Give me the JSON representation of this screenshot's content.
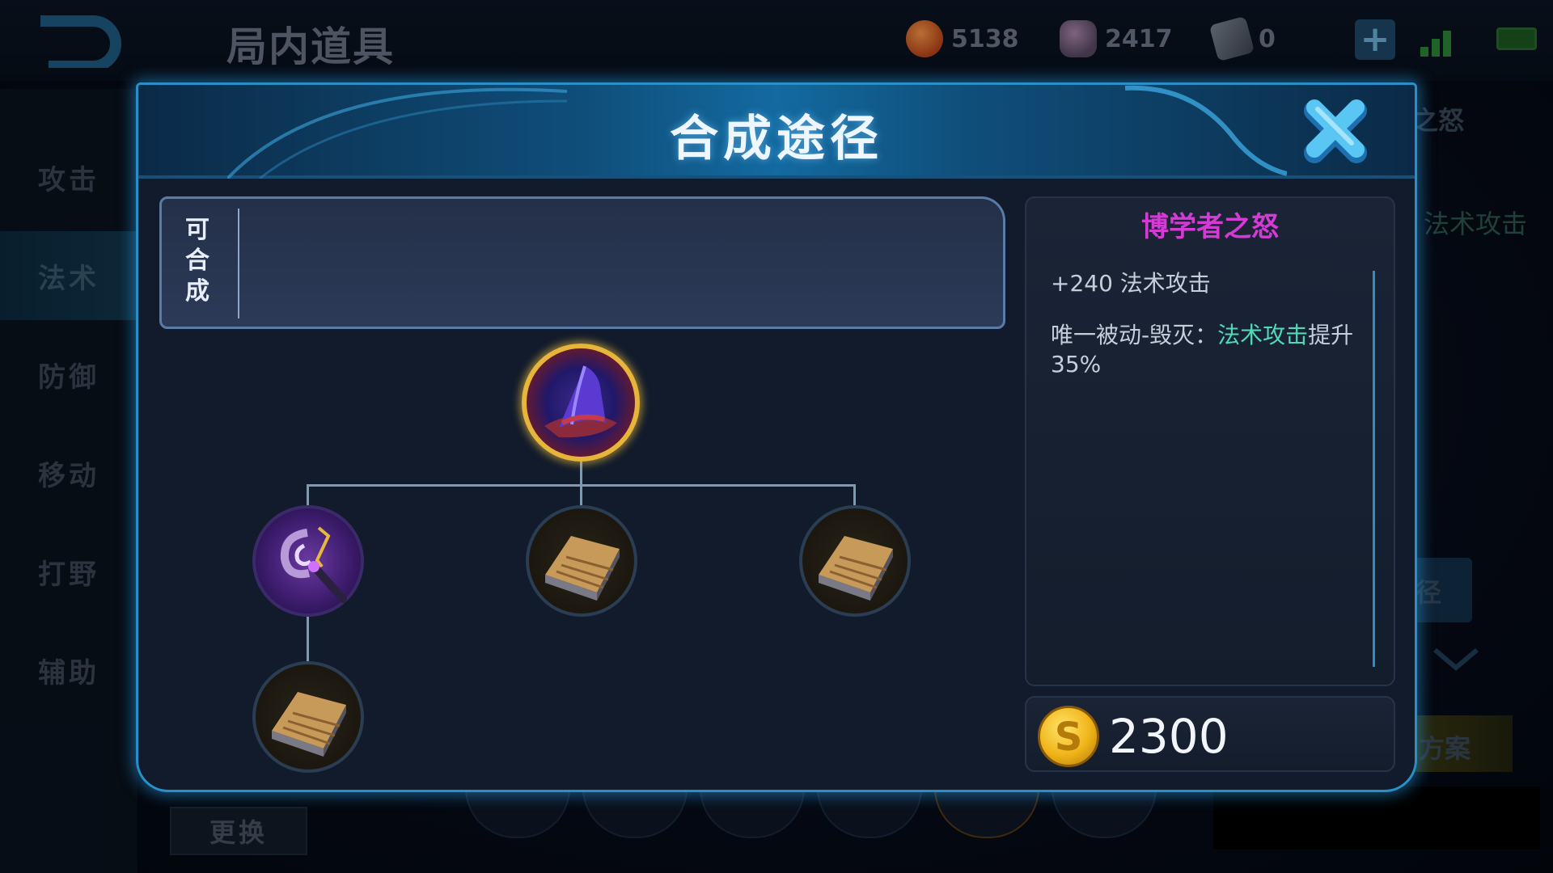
{
  "topbar": {
    "title": "局内道具",
    "gold_amount": "5138",
    "diamond_amount": "2417",
    "coupon_amount": "0",
    "plus_label": "+"
  },
  "sidebar": {
    "items": [
      {
        "label": "攻击"
      },
      {
        "label": "法术"
      },
      {
        "label": "防御"
      },
      {
        "label": "移动"
      },
      {
        "label": "打野"
      },
      {
        "label": "辅助"
      }
    ],
    "active_index": 1
  },
  "background_right": {
    "peek_title": "之怒",
    "peek_stat": "法术攻击",
    "peek_button": "径",
    "peek_plan": "方案"
  },
  "bottom": {
    "swap_label": "更换"
  },
  "modal": {
    "title": "合成途径",
    "compose_label": [
      "可",
      "合",
      "成"
    ],
    "tree": {
      "root": {
        "name": "博学者之怒",
        "icon": "wizard-hat-icon"
      },
      "children": [
        {
          "icon": "staff-icon",
          "children": [
            {
              "icon": "book-icon"
            }
          ]
        },
        {
          "icon": "book-icon"
        },
        {
          "icon": "book-icon"
        }
      ]
    },
    "info": {
      "name": "博学者之怒",
      "stat": "+240 法术攻击",
      "passive_prefix": "唯一被动-毁灭：",
      "passive_highlight": "法术攻击",
      "passive_suffix": "提升35%",
      "price": "2300"
    }
  },
  "colors": {
    "accent_border": "#2a8fc6",
    "item_name": "#d43ad4",
    "highlight": "#4fd9b8",
    "gold": "#f0b418"
  }
}
